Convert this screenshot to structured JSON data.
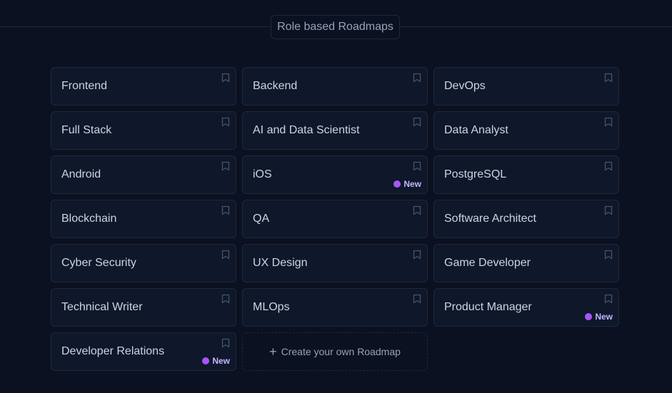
{
  "section": {
    "label": "Role based Roadmaps"
  },
  "roadmaps": [
    {
      "label": "Frontend",
      "new": false
    },
    {
      "label": "Backend",
      "new": false
    },
    {
      "label": "DevOps",
      "new": false
    },
    {
      "label": "Full Stack",
      "new": false
    },
    {
      "label": "AI and Data Scientist",
      "new": false
    },
    {
      "label": "Data Analyst",
      "new": false
    },
    {
      "label": "Android",
      "new": false
    },
    {
      "label": "iOS",
      "new": true
    },
    {
      "label": "PostgreSQL",
      "new": false
    },
    {
      "label": "Blockchain",
      "new": false
    },
    {
      "label": "QA",
      "new": false
    },
    {
      "label": "Software Architect",
      "new": false
    },
    {
      "label": "Cyber Security",
      "new": false
    },
    {
      "label": "UX Design",
      "new": false
    },
    {
      "label": "Game Developer",
      "new": false
    },
    {
      "label": "Technical Writer",
      "new": false
    },
    {
      "label": "MLOps",
      "new": false
    },
    {
      "label": "Product Manager",
      "new": true
    },
    {
      "label": "Developer Relations",
      "new": true
    }
  ],
  "new_badge_label": "New",
  "create": {
    "label": "Create your own Roadmap",
    "icon": "plus-icon"
  },
  "colors": {
    "background": "#0b1120",
    "card": "#0f172a",
    "border": "#1e293b",
    "badge_dot": "#a855f7"
  }
}
